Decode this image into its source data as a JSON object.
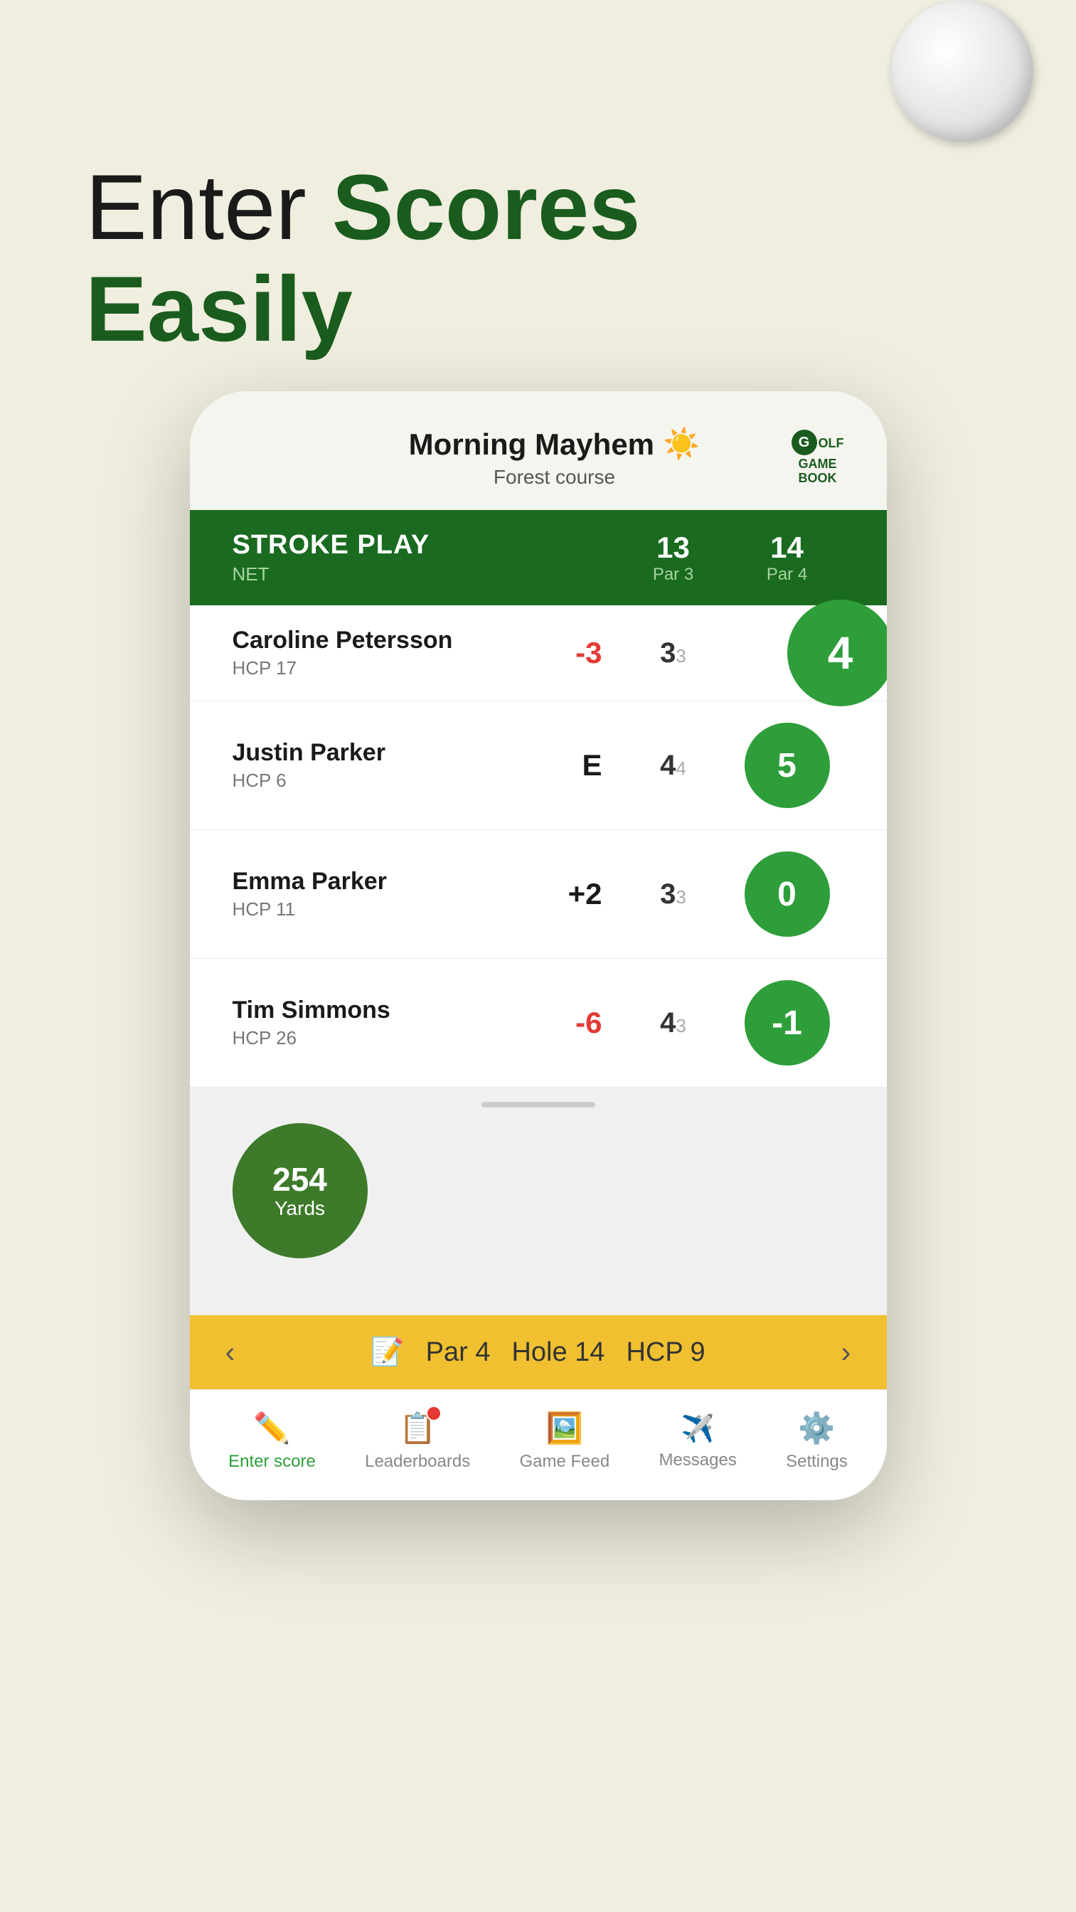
{
  "hero": {
    "line1": "Enter ",
    "line1_bold": "Scores",
    "line2_bold": "Easily"
  },
  "game": {
    "title": "Morning Mayhem",
    "title_emoji": "☀️",
    "course": "Forest course",
    "logo_text": "GOLF\nGAME\nBOOK"
  },
  "score_table": {
    "play_type": "STROKE PLAY",
    "net_label": "NET",
    "holes": [
      {
        "number": "13",
        "par": "Par 3"
      },
      {
        "number": "14",
        "par": "Par 4"
      }
    ]
  },
  "players": [
    {
      "name": "Caroline Petersson",
      "hcp": "HCP 17",
      "total": "-3",
      "total_color": "red",
      "hole13_score": "3",
      "hole13_par": "3",
      "hole14_score": "4",
      "hole14_active": true
    },
    {
      "name": "Justin Parker",
      "hcp": "HCP 6",
      "total": "E",
      "total_color": "black",
      "hole13_score": "4",
      "hole13_par": "4",
      "hole14_score": "5",
      "hole14_active": false
    },
    {
      "name": "Emma Parker",
      "hcp": "HCP 11",
      "total": "+2",
      "total_color": "black",
      "hole13_score": "3",
      "hole13_par": "3",
      "hole14_score": "0",
      "hole14_active": false
    },
    {
      "name": "Tim Simmons",
      "hcp": "HCP 26",
      "total": "-6",
      "total_color": "red",
      "hole13_score": "4",
      "hole13_par": "3",
      "hole14_score": "-1",
      "hole14_active": false
    }
  ],
  "hole_map": {
    "yards": "254",
    "yards_label": "Yards"
  },
  "hole_nav": {
    "par": "Par 4",
    "hole": "Hole 14",
    "hcp": "HCP 9",
    "prev_arrow": "‹",
    "next_arrow": "›"
  },
  "bottom_nav": {
    "items": [
      {
        "icon": "✏️",
        "label": "Enter score",
        "active": true
      },
      {
        "icon": "📋",
        "label": "Leaderboards",
        "active": false,
        "badge": true
      },
      {
        "icon": "🖼️",
        "label": "Game Feed",
        "active": false
      },
      {
        "icon": "✈️",
        "label": "Messages",
        "active": false
      },
      {
        "icon": "⚙️",
        "label": "Settings",
        "active": false
      }
    ]
  }
}
